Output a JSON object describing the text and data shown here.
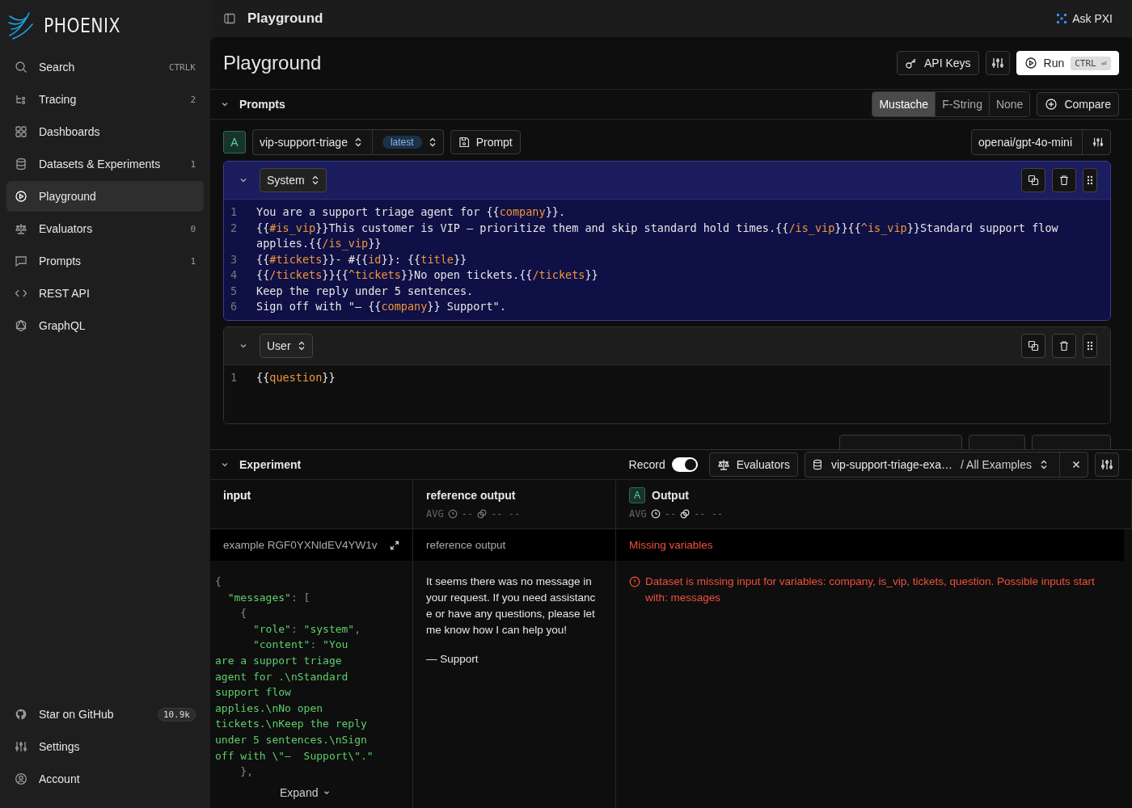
{
  "brand": {
    "name": "PHOENIX"
  },
  "sidebar": {
    "items": [
      {
        "label": "Search",
        "kind": "search",
        "badge": "CTRLK",
        "selected": false
      },
      {
        "label": "Tracing",
        "kind": "tracing",
        "badge": "2",
        "selected": false
      },
      {
        "label": "Dashboards",
        "kind": "dashboards",
        "selected": false
      },
      {
        "label": "Datasets & Experiments",
        "kind": "datasets",
        "badge": "1",
        "selected": false
      },
      {
        "label": "Playground",
        "kind": "playground",
        "selected": true
      },
      {
        "label": "Evaluators",
        "kind": "evaluators",
        "badge": "0",
        "selected": false
      },
      {
        "label": "Prompts",
        "kind": "prompts",
        "badge": "1",
        "selected": false
      },
      {
        "label": "REST API",
        "kind": "rest",
        "selected": false
      },
      {
        "label": "GraphQL",
        "kind": "graphql",
        "selected": false
      }
    ],
    "footer_items": [
      {
        "label": "Star on GitHub",
        "kind": "github",
        "badge": "10.9k"
      },
      {
        "label": "Settings",
        "kind": "settings"
      },
      {
        "label": "Account",
        "kind": "account"
      }
    ]
  },
  "top_bar": {
    "title": "Playground",
    "ask_button": "Ask PXI"
  },
  "page": {
    "title": "Playground",
    "api_keys_button": "API Keys",
    "run_button": "Run",
    "run_shortcut": "CTRL ⏎"
  },
  "prompts": {
    "title": "Prompts",
    "expanded": true,
    "template_formats": [
      {
        "label": "Mustache",
        "selected": true
      },
      {
        "label": "F-String",
        "selected": false
      },
      {
        "label": "None",
        "selected": false
      }
    ],
    "compare_button": "Compare",
    "instance": {
      "letter": "A",
      "prompt_name": "vip-support-triage",
      "version": "latest",
      "prompt_button": "Prompt",
      "model": "openai/gpt-4o-mini"
    },
    "messages": [
      {
        "role": "System",
        "expanded": true,
        "kind": "system",
        "lines": [
          {
            "number": "1",
            "segments": [
              {
                "text": "You are a support triage agent for {{",
                "kind": "plain"
              },
              {
                "text": "company",
                "kind": "var"
              },
              {
                "text": "}}.",
                "kind": "plain"
              }
            ]
          },
          {
            "number": "2",
            "segments": [
              {
                "text": "{{",
                "kind": "plain"
              },
              {
                "text": "#is_vip",
                "kind": "var"
              },
              {
                "text": "}}This customer is VIP — prioritize them and skip standard hold times.{{",
                "kind": "plain"
              },
              {
                "text": "/is_vip",
                "kind": "var"
              },
              {
                "text": "}}{{",
                "kind": "plain"
              },
              {
                "text": "^is_vip",
                "kind": "var"
              },
              {
                "text": "}}Standard support flow applies.{{",
                "kind": "plain"
              },
              {
                "text": "/is_vip",
                "kind": "var"
              },
              {
                "text": "}}",
                "kind": "plain"
              }
            ]
          },
          {
            "number": "3",
            "segments": [
              {
                "text": "{{",
                "kind": "plain"
              },
              {
                "text": "#tickets",
                "kind": "var"
              },
              {
                "text": "}}- #{{",
                "kind": "plain"
              },
              {
                "text": "id",
                "kind": "var"
              },
              {
                "text": "}}: {{",
                "kind": "plain"
              },
              {
                "text": "title",
                "kind": "var"
              },
              {
                "text": "}}",
                "kind": "plain"
              }
            ]
          },
          {
            "number": "4",
            "segments": [
              {
                "text": "{{",
                "kind": "plain"
              },
              {
                "text": "/tickets",
                "kind": "var"
              },
              {
                "text": "}}{{",
                "kind": "plain"
              },
              {
                "text": "^tickets",
                "kind": "var"
              },
              {
                "text": "}}No open tickets.{{",
                "kind": "plain"
              },
              {
                "text": "/tickets",
                "kind": "var"
              },
              {
                "text": "}}",
                "kind": "plain"
              }
            ]
          },
          {
            "number": "5",
            "segments": [
              {
                "text": "Keep the reply under 5 sentences.",
                "kind": "plain"
              }
            ]
          },
          {
            "number": "6",
            "segments": [
              {
                "text": "Sign off with \"— {{",
                "kind": "plain"
              },
              {
                "text": "company",
                "kind": "var"
              },
              {
                "text": "}} Support\".",
                "kind": "plain"
              }
            ]
          }
        ]
      },
      {
        "role": "User",
        "expanded": true,
        "kind": "user",
        "lines": [
          {
            "number": "1",
            "segments": [
              {
                "text": "{{",
                "kind": "plain"
              },
              {
                "text": "question",
                "kind": "var"
              },
              {
                "text": "}}",
                "kind": "plain"
              }
            ]
          }
        ]
      }
    ]
  },
  "experiment": {
    "title": "Experiment",
    "expanded": true,
    "record_label": "Record",
    "record_on": true,
    "evaluators_button": "Evaluators",
    "dataset": "vip-support-triage-exa…",
    "split": "/ All Examples",
    "columns": [
      {
        "kind": "input",
        "title": "input"
      },
      {
        "kind": "reference",
        "title": "reference output",
        "avg": "AVG",
        "latency": "--",
        "tokens": "-- --"
      },
      {
        "kind": "output",
        "letter": "A",
        "title": "Output",
        "avg": "AVG",
        "latency": "--",
        "tokens": "-- --"
      }
    ],
    "row": {
      "example_label": "example RGF0YXNldEV4YW1v",
      "reference_label": "reference output",
      "output_label": "Missing variables",
      "input_lines": [
        [
          {
            "text": "{",
            "kind": "punct"
          }
        ],
        [
          {
            "text": "  \"messages\"",
            "kind": "string"
          },
          {
            "text": ": [",
            "kind": "punct"
          }
        ],
        [
          {
            "text": "    {",
            "kind": "punct"
          }
        ],
        [
          {
            "text": "      \"role\"",
            "kind": "string"
          },
          {
            "text": ": ",
            "kind": "punct"
          },
          {
            "text": "\"system\"",
            "kind": "string"
          },
          {
            "text": ",",
            "kind": "punct"
          }
        ],
        [
          {
            "text": "      \"content\"",
            "kind": "string"
          },
          {
            "text": ": ",
            "kind": "punct"
          },
          {
            "text": "\"You",
            "kind": "string"
          }
        ],
        [
          {
            "text": "are a support triage",
            "kind": "string"
          }
        ],
        [
          {
            "text": "agent for .\\nStandard",
            "kind": "string"
          }
        ],
        [
          {
            "text": "support flow",
            "kind": "string"
          }
        ],
        [
          {
            "text": "applies.\\nNo open",
            "kind": "string"
          }
        ],
        [
          {
            "text": "tickets.\\nKeep the reply",
            "kind": "string"
          }
        ],
        [
          {
            "text": "under 5 sentences.\\nSign",
            "kind": "string"
          }
        ],
        [
          {
            "text": "off with \\\"—  Support\\\".\"",
            "kind": "string"
          }
        ],
        [
          {
            "text": "    },",
            "kind": "punct"
          }
        ]
      ],
      "expand_button": "Expand",
      "reference_paragraphs": [
        "It seems there was no message in your request. If you need assistance or have any questions, please let me know how I can help you!",
        "— Support"
      ],
      "error_message": "Dataset is missing input for variables: company, is_vip, tickets, question. Possible inputs start with: messages"
    }
  }
}
